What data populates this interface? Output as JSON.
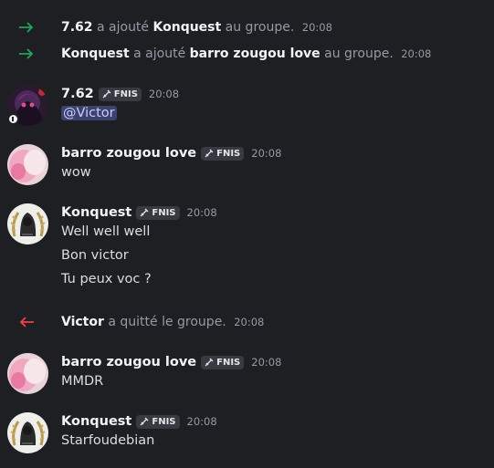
{
  "system_events": [
    {
      "actor": "7.62",
      "action": "a ajouté",
      "target": "Konquest",
      "suffix": "au groupe.",
      "time": "20:08",
      "icon": "arrow-right-icon",
      "color": "#23a55a"
    },
    {
      "actor": "Konquest",
      "action": "a ajouté",
      "target": "barro zougou love",
      "suffix": "au groupe.",
      "time": "20:08",
      "icon": "arrow-right-icon",
      "color": "#23a55a"
    },
    {
      "actor": "Victor",
      "action": "a quitté le groupe.",
      "time": "20:08",
      "icon": "arrow-left-icon",
      "color": "#f23f43"
    }
  ],
  "messages": [
    {
      "author": "7.62",
      "tag": "FNIS",
      "time": "20:08",
      "lines": [
        "@Victor"
      ],
      "avatar": "dark-anime-avatar"
    },
    {
      "author": "barro zougou love",
      "tag": "FNIS",
      "time": "20:08",
      "lines": [
        "wow"
      ],
      "avatar": "pink-blur-avatar"
    },
    {
      "author": "Konquest",
      "tag": "FNIS",
      "time": "20:08",
      "lines": [
        "Well well well",
        "Bon victor",
        "Tu peux voc ?"
      ],
      "avatar": "laurel-crest-avatar"
    },
    {
      "author": "barro zougou love",
      "tag": "FNIS",
      "time": "20:08",
      "lines": [
        "MMDR"
      ],
      "avatar": "pink-blur-avatar"
    },
    {
      "author": "Konquest",
      "tag": "FNIS",
      "time": "20:08",
      "lines": [
        "Starfoudebian"
      ],
      "avatar": "laurel-crest-avatar"
    }
  ],
  "colors": {
    "background": "#1e1f22",
    "join_arrow": "#23a55a",
    "leave_arrow": "#f23f43",
    "mention_bg": "#3c4270"
  }
}
